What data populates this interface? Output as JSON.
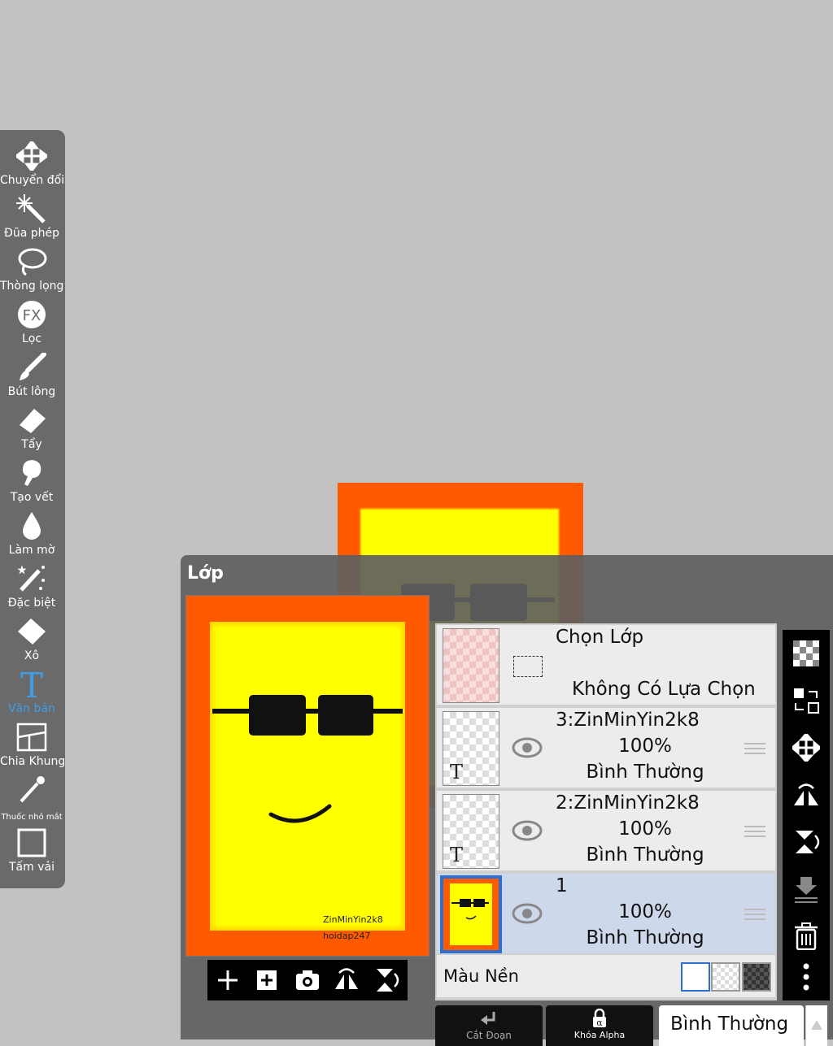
{
  "tools": [
    {
      "name": "move-icon",
      "label": "Chuyển đổi"
    },
    {
      "name": "magic-wand-icon",
      "label": "Đũa phép"
    },
    {
      "name": "lasso-icon",
      "label": "Thòng lọng"
    },
    {
      "name": "fx-icon",
      "label": "Lọc"
    },
    {
      "name": "brush-icon",
      "label": "Bút lông"
    },
    {
      "name": "eraser-icon",
      "label": "Tẩy"
    },
    {
      "name": "smudge-icon",
      "label": "Tạo vết"
    },
    {
      "name": "blur-drop-icon",
      "label": "Làm mờ"
    },
    {
      "name": "special-wand-icon",
      "label": "Đặc biệt"
    },
    {
      "name": "bucket-icon",
      "label": "Xô"
    },
    {
      "name": "text-icon",
      "label": "Văn bản",
      "active": true
    },
    {
      "name": "frame-divider-icon",
      "label": "Chia Khung"
    },
    {
      "name": "eyedropper-icon",
      "label": "Thuốc nhỏ mắt"
    },
    {
      "name": "canvas-icon",
      "label": "Tấm vải"
    }
  ],
  "panel": {
    "title": "Lớp",
    "preview_text_1": "ZinMinYin2k8",
    "preview_text_2": "hoidap247"
  },
  "selection_layer": {
    "title": "Chọn Lớp",
    "status": "Không Có Lựa Chọn"
  },
  "layers": [
    {
      "name": "3:ZinMinYin2k8",
      "opacity": "100%",
      "blend": "Bình Thường",
      "type": "text"
    },
    {
      "name": "2:ZinMinYin2k8",
      "opacity": "100%",
      "blend": "Bình Thường",
      "type": "text"
    },
    {
      "name": "1",
      "opacity": "100%",
      "blend": "Bình Thường",
      "type": "image",
      "selected": true
    }
  ],
  "background": {
    "label": "Màu Nền"
  },
  "bottom": {
    "clip_label": "Cắt Đoạn",
    "alpha_label": "Khóa Alpha",
    "blend_mode": "Bình Thường"
  },
  "colors": {
    "accent": "#3e9de6",
    "orange": "#ff5a00",
    "yellow": "#ffff00"
  }
}
